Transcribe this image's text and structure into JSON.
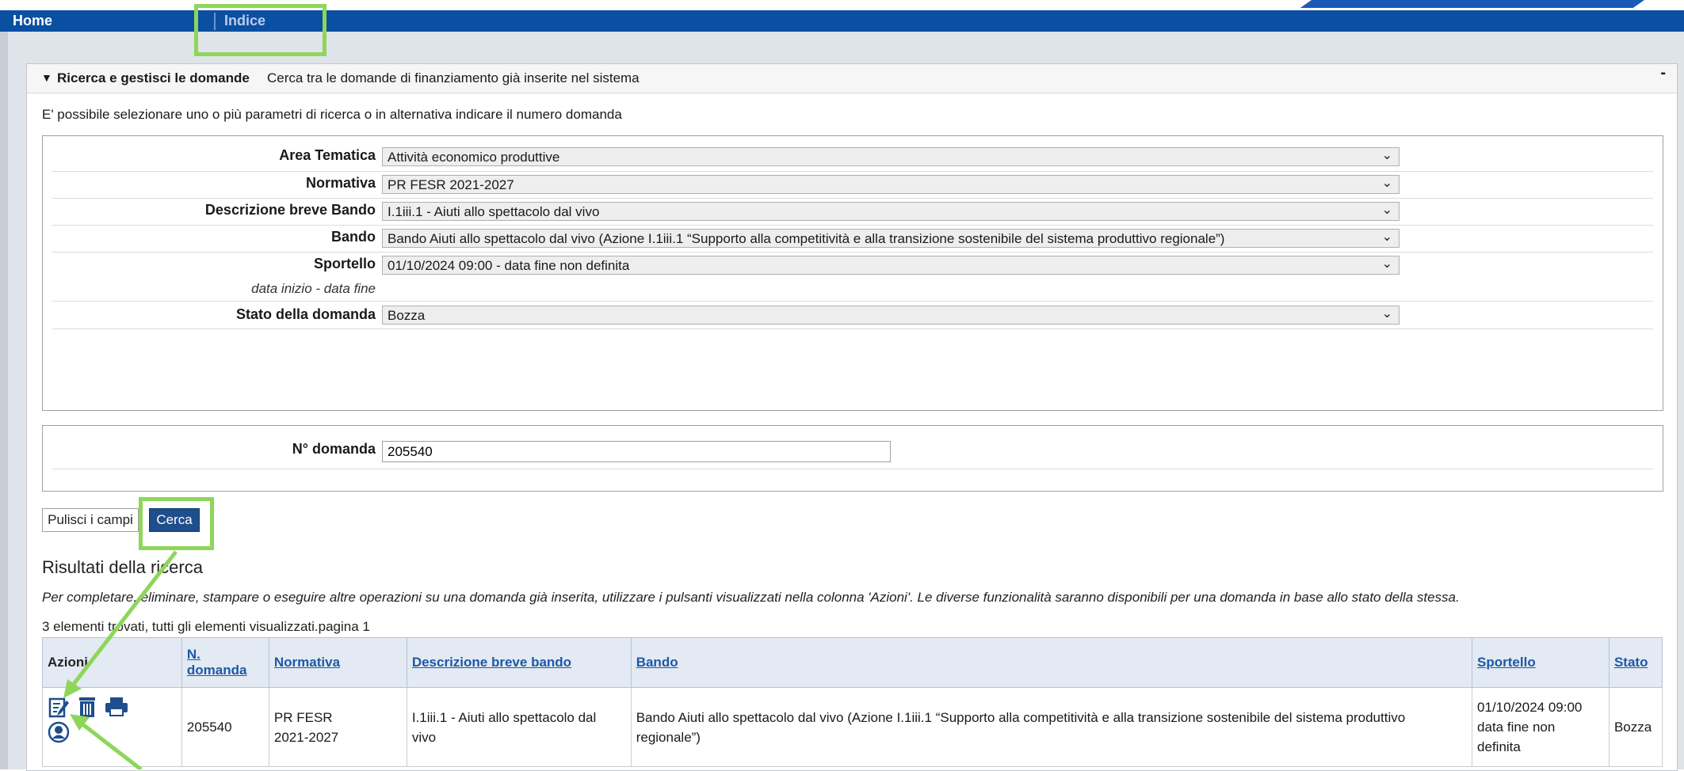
{
  "nav": {
    "home": "Home",
    "indice": "Indice"
  },
  "panel": {
    "title": "Ricerca e gestisci le domande",
    "subtitle": "Cerca tra le domande di finanziamento già inserite nel sistema",
    "collapse": "-"
  },
  "intro": "E' possibile selezionare uno o più parametri di ricerca o in alternativa indicare il numero domanda",
  "form": {
    "area_label": "Area Tematica",
    "area_value": "Attività economico produttive",
    "normativa_label": "Normativa",
    "normativa_value": "PR FESR 2021-2027",
    "descr_label": "Descrizione breve Bando",
    "descr_value": "I.1iii.1 - Aiuti allo spettacolo dal vivo",
    "bando_label": "Bando",
    "bando_value": "Bando Aiuti allo spettacolo dal vivo (Azione I.1iii.1 “Supporto alla competitività e alla transizione sostenibile del sistema produttivo regionale”)",
    "sportello_label": "Sportello",
    "sportello_sub": "data inizio - data fine",
    "sportello_value": "01/10/2024 09:00 - data fine non definita",
    "stato_label": "Stato della domanda",
    "stato_value": "Bozza",
    "ndomanda_label": "N° domanda",
    "ndomanda_value": "205540"
  },
  "buttons": {
    "clear": "Pulisci i campi",
    "search": "Cerca"
  },
  "results": {
    "title": "Risultati della ricerca",
    "note": "Per completare, eliminare, stampare o eseguire altre operazioni su una domanda già inserita, utilizzare i pulsanti visualizzati nella colonna 'Azioni'. Le diverse funzionalità saranno disponibili per una domanda in base allo stato della stessa.",
    "count": "3 elementi trovati, tutti gli elementi visualizzati.pagina 1",
    "headers": {
      "azioni": "Azioni",
      "ndomanda_1": "N.",
      "ndomanda_2": "domanda",
      "normativa": "Normativa",
      "descr": "Descrizione breve bando",
      "bando": "Bando",
      "sportello": "Sportello",
      "stato": "Stato"
    },
    "row": {
      "ndomanda": "205540",
      "normativa_1": "PR FESR",
      "normativa_2": "2021-2027",
      "descr_1": "I.1iii.1 - Aiuti allo spettacolo dal",
      "descr_2": "vivo",
      "bando_1": "Bando Aiuti allo spettacolo dal vivo (Azione I.1iii.1 “Supporto alla competitività e alla transizione sostenibile del sistema produttivo",
      "bando_2": "regionale”)",
      "sportello_1": "01/10/2024 09:00",
      "sportello_2": "data fine non",
      "sportello_3": "definita",
      "stato": "Bozza"
    },
    "action_icons": [
      "edit-icon",
      "trash-icon",
      "print-icon",
      "user-icon"
    ]
  },
  "colors": {
    "nav_blue": "#0b4fa3",
    "highlight": "#8ed65a",
    "button_blue": "#1e4e8c",
    "link": "#1e58a6"
  }
}
